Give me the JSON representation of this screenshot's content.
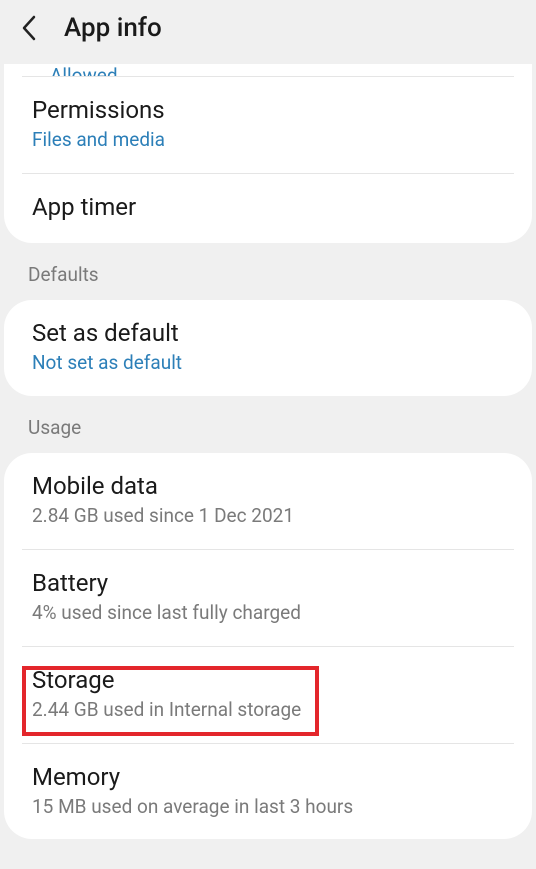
{
  "header": {
    "title": "App info"
  },
  "clipped_subtitle_top": "Allowed",
  "section1": {
    "permissions": {
      "title": "Permissions",
      "sub": "Files and media"
    },
    "app_timer": {
      "title": "App timer"
    }
  },
  "defaults": {
    "label": "Defaults",
    "set_default": {
      "title": "Set as default",
      "sub": "Not set as default"
    }
  },
  "usage": {
    "label": "Usage",
    "mobile_data": {
      "title": "Mobile data",
      "sub": "2.84 GB used since 1 Dec 2021"
    },
    "battery": {
      "title": "Battery",
      "sub": "4% used since last fully charged"
    },
    "storage": {
      "title": "Storage",
      "sub": "2.44 GB used in Internal storage"
    },
    "memory": {
      "title": "Memory",
      "sub": "15 MB used on average in last 3 hours"
    }
  }
}
